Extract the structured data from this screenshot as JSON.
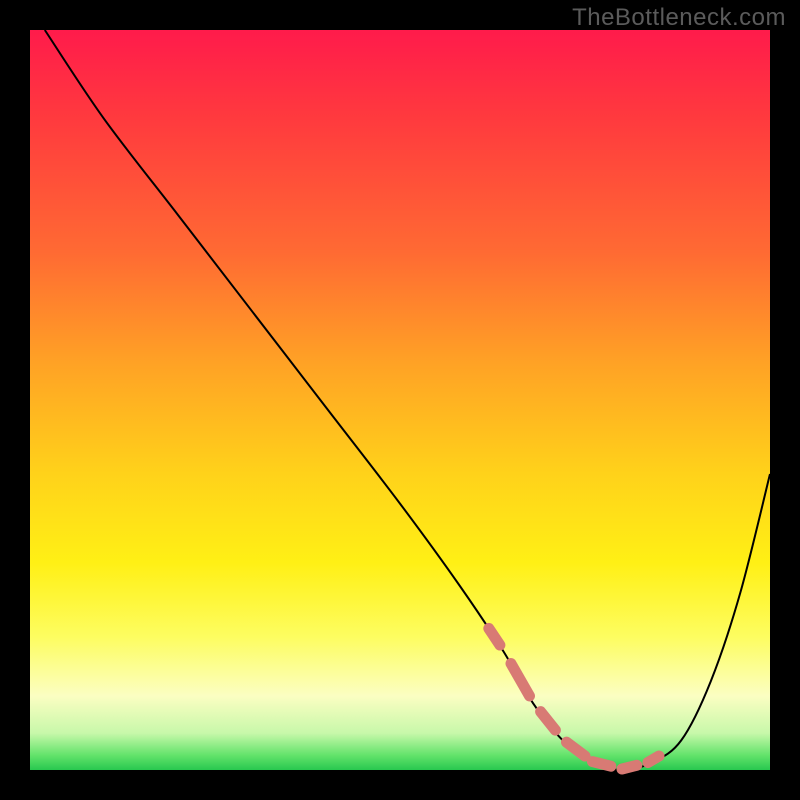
{
  "watermark": "TheBottleneck.com",
  "chart_data": {
    "type": "line",
    "title": "",
    "xlabel": "",
    "ylabel": "",
    "xlim": [
      0,
      100
    ],
    "ylim": [
      0,
      100
    ],
    "series": [
      {
        "name": "curve",
        "x": [
          2,
          10,
          20,
          30,
          40,
          50,
          58,
          64,
          68,
          72,
          76,
          80,
          84,
          88,
          92,
          96,
          100
        ],
        "y": [
          100,
          88,
          75,
          62,
          49,
          36,
          25,
          16,
          9,
          4,
          1,
          0,
          1,
          4,
          12,
          24,
          40
        ]
      }
    ],
    "annotations": {
      "bottom_dashes_x_range": [
        62,
        85
      ],
      "bottom_dashes_y": 0
    },
    "colors": {
      "curve": "#000000",
      "dashes": "#d87a74",
      "gradient_top": "#ff1b4b",
      "gradient_bottom": "#28c84f"
    }
  }
}
